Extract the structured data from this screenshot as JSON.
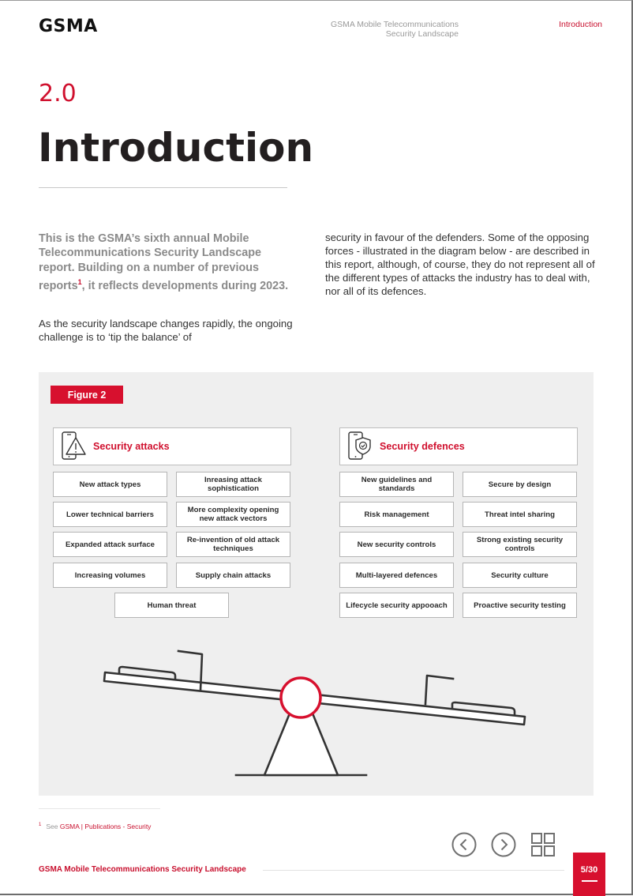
{
  "header": {
    "logo": "GSMA",
    "doc_title_line1": "GSMA Mobile Telecommunications",
    "doc_title_line2": "Security Landscape",
    "section_link": "Introduction"
  },
  "section": {
    "number": "2.0",
    "title": "Introduction"
  },
  "intro": {
    "lead_before": "This is the GSMA’s sixth annual Mobile Telecommunications Security Landscape report. Building on a number of previous reports",
    "lead_sup": "1",
    "lead_after": ", it reflects developments during 2023.",
    "para1": "As the security landscape changes rapidly, the ongoing challenge is to ‘tip the balance’ of",
    "para2": "security in favour of the defenders. Some of the opposing forces - illustrated in the diagram below - are described in this report, although, of course, they do not represent all of the different types of attacks the industry has to deal with, nor all of its defences."
  },
  "figure": {
    "label": "Figure 2",
    "attacks": {
      "title": "Security attacks",
      "icon": "phone-warning-icon",
      "items": [
        "New attack types",
        "Inreasing attack sophistication",
        "Lower technical barriers",
        "More complexity opening new attack vectors",
        "Expanded attack surface",
        "Re-invention of old attack techniques",
        "Increasing volumes",
        "Supply chain attacks",
        "Human threat"
      ]
    },
    "defences": {
      "title": "Security defences",
      "icon": "phone-shield-icon",
      "items": [
        "New guidelines and standards",
        "Secure by design",
        "Risk management",
        "Threat intel sharing",
        "New security controls",
        "Strong existing security controls",
        "Multi-layered defences",
        "Security culture",
        "Lifecycle security appooach",
        "Proactive security testing"
      ]
    },
    "illustration": "seesaw-icon",
    "colors": {
      "accent": "#d7102e",
      "panel": "#efefef",
      "line": "#333333"
    }
  },
  "footnote": {
    "number": "1",
    "prefix": "See",
    "link": "GSMA | Publications - Security"
  },
  "footer": {
    "title": "GSMA Mobile Telecommunications Security Landscape",
    "page": "5/30",
    "nav": {
      "prev": "chevron-left-icon",
      "next": "chevron-right-icon",
      "grid": "grid-icon"
    }
  }
}
